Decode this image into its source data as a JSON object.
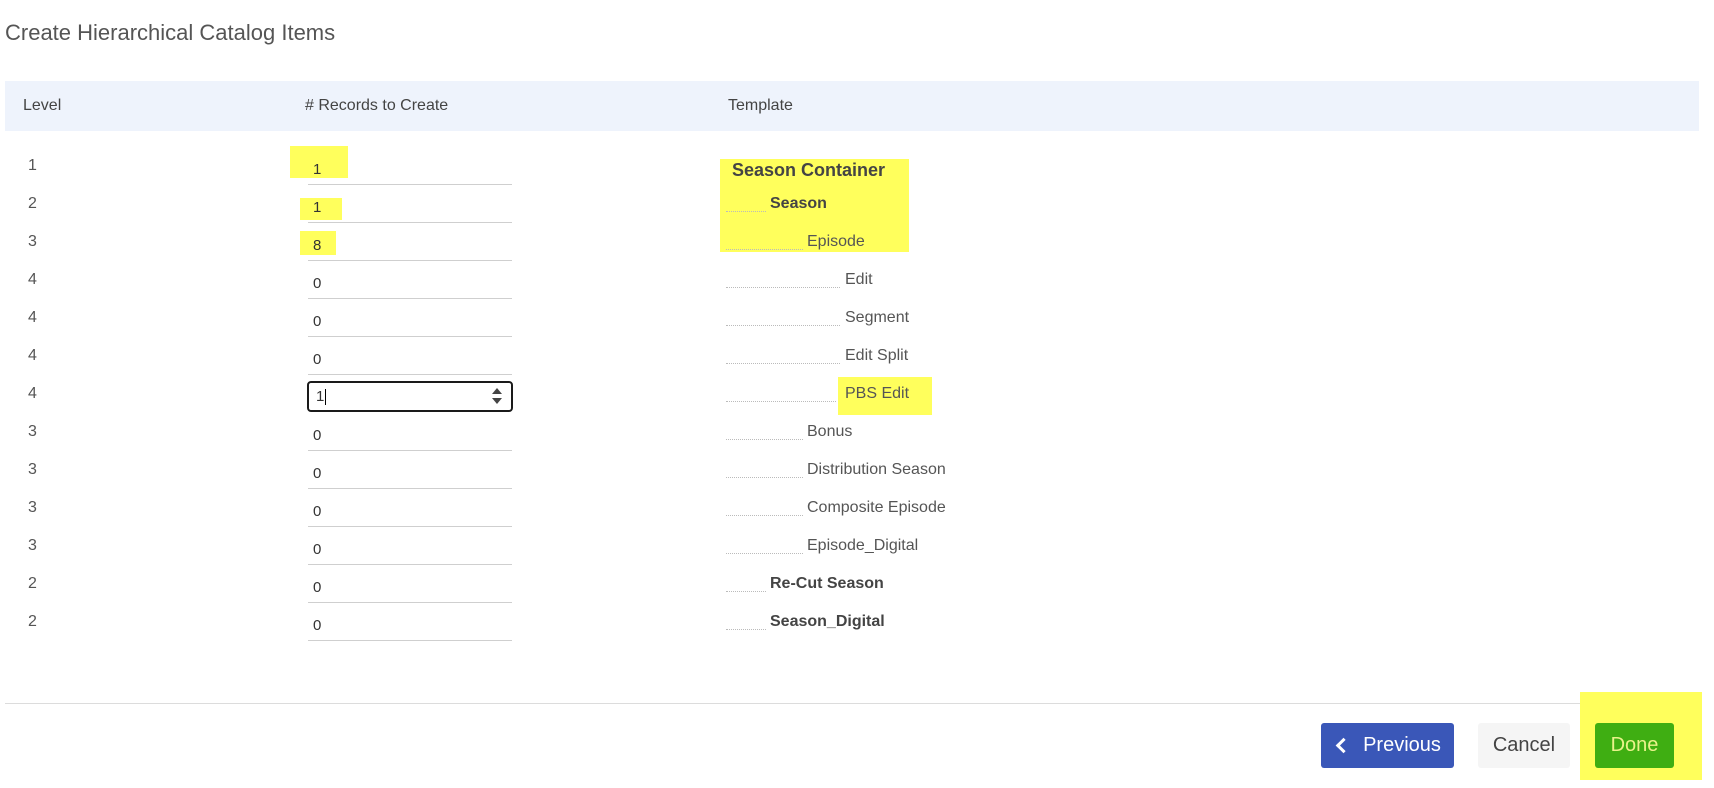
{
  "title": "Create Hierarchical Catalog Items",
  "columns": {
    "level": "Level",
    "records": "# Records to Create",
    "template": "Template"
  },
  "rows": [
    {
      "level": "1",
      "records": "1",
      "template": "Season Container"
    },
    {
      "level": "2",
      "records": "1",
      "template": "Season"
    },
    {
      "level": "3",
      "records": "8",
      "template": "Episode"
    },
    {
      "level": "4",
      "records": "0",
      "template": "Edit"
    },
    {
      "level": "4",
      "records": "0",
      "template": "Segment"
    },
    {
      "level": "4",
      "records": "0",
      "template": "Edit Split"
    },
    {
      "level": "4",
      "records": "1",
      "template": "PBS Edit"
    },
    {
      "level": "3",
      "records": "0",
      "template": "Bonus"
    },
    {
      "level": "3",
      "records": "0",
      "template": "Distribution Season"
    },
    {
      "level": "3",
      "records": "0",
      "template": "Composite Episode"
    },
    {
      "level": "3",
      "records": "0",
      "template": "Episode_Digital"
    },
    {
      "level": "2",
      "records": "0",
      "template": "Re-Cut Season"
    },
    {
      "level": "2",
      "records": "0",
      "template": "Season_Digital"
    }
  ],
  "buttons": {
    "previous": "Previous",
    "cancel": "Cancel",
    "done": "Done"
  },
  "colors": {
    "highlight": "#ffff5c",
    "previous_bg": "#3a57b8",
    "done_bg": "#3fae12",
    "header_bg": "#eef3fc"
  }
}
